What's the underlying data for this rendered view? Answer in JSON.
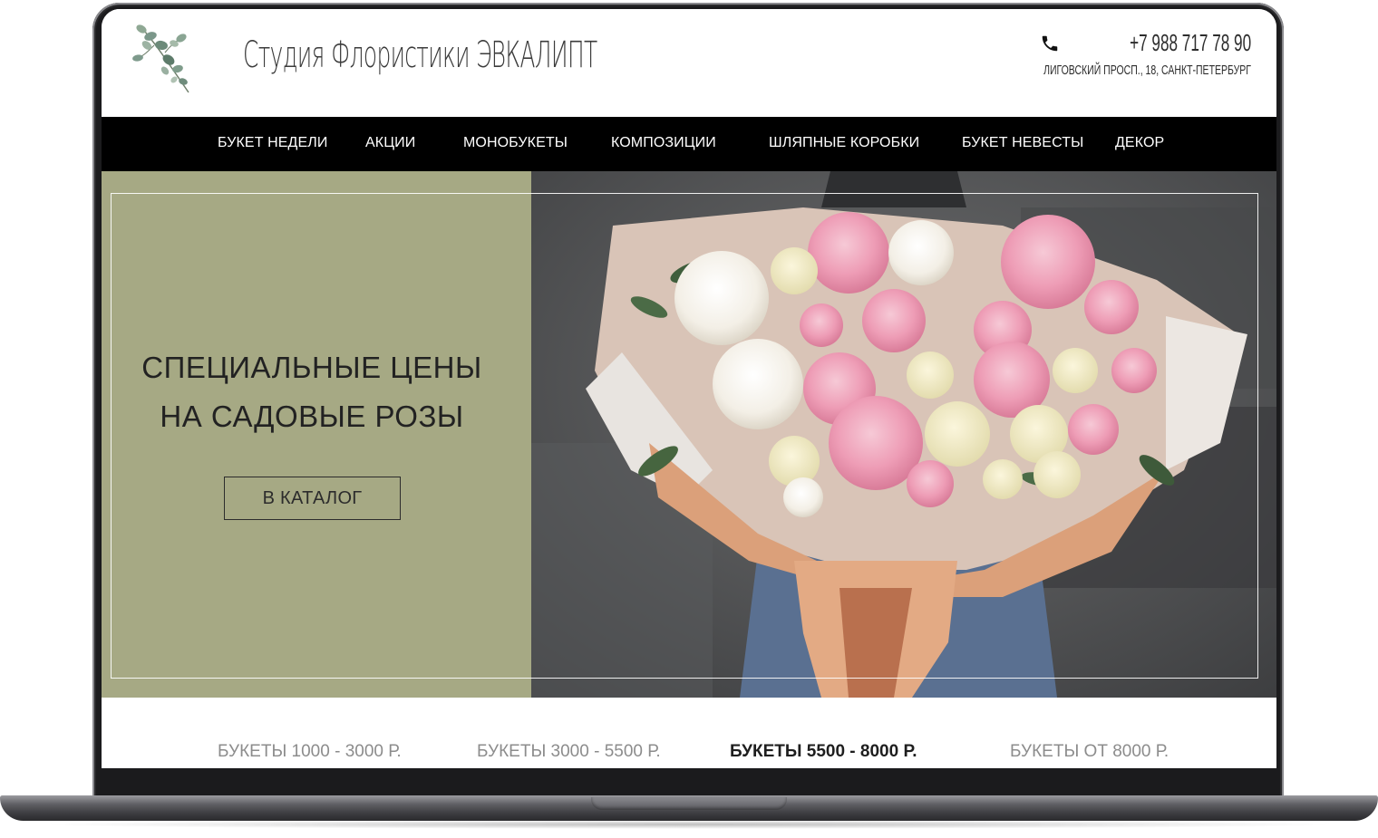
{
  "header": {
    "brand": "Студия Флористики ЭВКАЛИПТ",
    "phone": "+7 988 717 78 90",
    "address": "ЛИГОВСКИЙ ПРОСП., 18, САНКТ-ПЕТЕРБУРГ",
    "logo_icon": "eucalyptus-sprig-icon",
    "phone_icon": "phone-icon"
  },
  "nav": {
    "items": [
      {
        "label": "БУКЕТ НЕДЕЛИ"
      },
      {
        "label": "АКЦИИ"
      },
      {
        "label": "МОНОБУКЕТЫ"
      },
      {
        "label": "КОМПОЗИЦИИ"
      },
      {
        "label": "ШЛЯПНЫЕ КОРОБКИ"
      },
      {
        "label": "БУКЕТ НЕВЕСТЫ"
      },
      {
        "label": "ДЕКОР"
      }
    ]
  },
  "hero": {
    "title_line1": "СПЕЦИАЛЬНЫЕ ЦЕНЫ",
    "title_line2": "НА САДОВЫЕ РОЗЫ",
    "button_label": "В КАТАЛОГ",
    "image": "bouquet-of-pink-and-white-roses-photo"
  },
  "price_tabs": {
    "items": [
      {
        "label": "БУКЕТЫ 1000 - 3000 Р.",
        "active": false
      },
      {
        "label": "БУКЕТЫ 3000 - 5500 Р.",
        "active": false
      },
      {
        "label": "БУКЕТЫ 5500 - 8000 Р.",
        "active": true
      },
      {
        "label": "БУКЕТЫ ОТ 8000 Р.",
        "active": false
      }
    ]
  },
  "colors": {
    "hero_panel": "#a6a984",
    "nav_bg": "#000000",
    "text_dark": "#222222",
    "tab_inactive": "#8c8c8c"
  }
}
